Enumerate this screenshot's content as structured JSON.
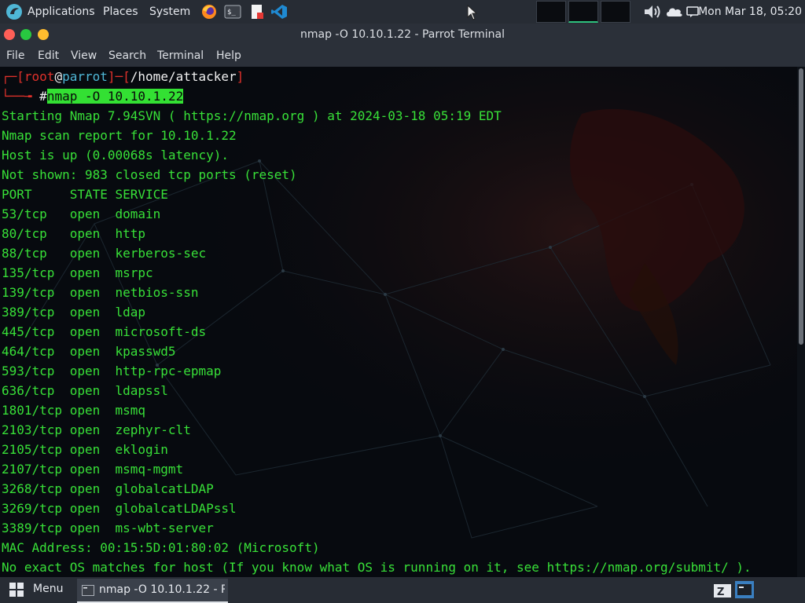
{
  "top_panel": {
    "applications": "Applications",
    "places": "Places",
    "system": "System",
    "clock": "Mon Mar 18, 05:20"
  },
  "window": {
    "title": "nmap -O 10.10.1.22 - Parrot Terminal"
  },
  "menubar": {
    "items": [
      "File",
      "Edit",
      "View",
      "Search",
      "Terminal",
      "Help"
    ]
  },
  "terminal": {
    "prompt_user": "root",
    "prompt_at": "@",
    "prompt_host": "parrot",
    "prompt_path": "/home/attacker",
    "prompt_hash": "#",
    "command": "nmap -O 10.10.1.22",
    "lines": [
      "Starting Nmap 7.94SVN ( https://nmap.org ) at 2024-03-18 05:19 EDT",
      "Nmap scan report for 10.10.1.22",
      "Host is up (0.00068s latency).",
      "Not shown: 983 closed tcp ports (reset)",
      "PORT     STATE SERVICE",
      "53/tcp   open  domain",
      "80/tcp   open  http",
      "88/tcp   open  kerberos-sec",
      "135/tcp  open  msrpc",
      "139/tcp  open  netbios-ssn",
      "389/tcp  open  ldap",
      "445/tcp  open  microsoft-ds",
      "464/tcp  open  kpasswd5",
      "593/tcp  open  http-rpc-epmap",
      "636/tcp  open  ldapssl",
      "1801/tcp open  msmq",
      "2103/tcp open  zephyr-clt",
      "2105/tcp open  eklogin",
      "2107/tcp open  msmq-mgmt",
      "3268/tcp open  globalcatLDAP",
      "3269/tcp open  globalcatLDAPssl",
      "3389/tcp open  ms-wbt-server",
      "MAC Address: 00:15:5D:01:80:02 (Microsoft)",
      "No exact OS matches for host (If you know what OS is running on it, see https://nmap.org/submit/ )."
    ]
  },
  "bottom_panel": {
    "menu_label": "Menu",
    "task_label": "nmap -O 10.10.1.22 - P..."
  },
  "colors": {
    "terminal_text": "#38e038",
    "prompt_red": "#e0312b",
    "panel_bg": "#272c34"
  }
}
